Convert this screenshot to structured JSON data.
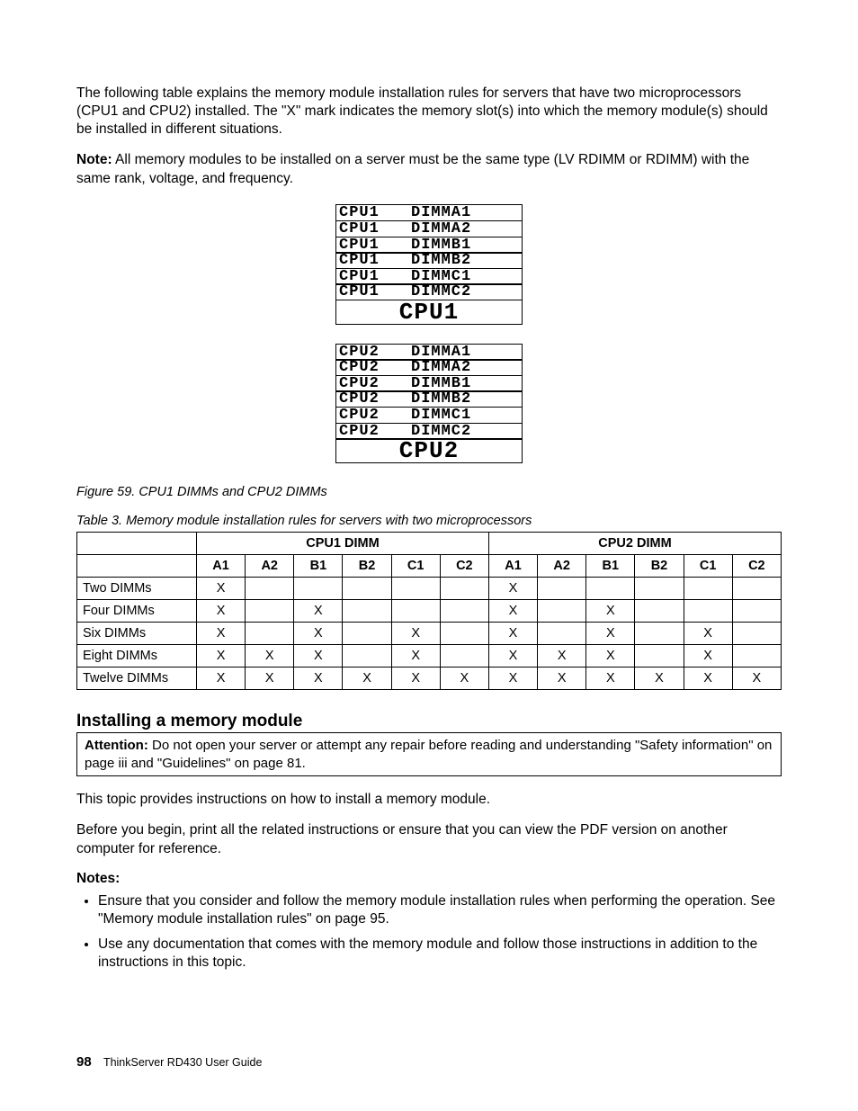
{
  "intro_para": "The following table explains the memory module installation rules for servers that have two microprocessors (CPU1 and CPU2) installed. The \"X\" mark indicates the memory slot(s) into which the memory module(s) should be installed in different situations.",
  "note_label": "Note:",
  "note_text": " All memory modules to be installed on a server must be the same type (LV RDIMM or RDIMM) with the same rank, voltage, and frequency.",
  "diagram": {
    "cpu1_rows": [
      [
        "CPU1",
        "DIMMA1"
      ],
      [
        "CPU1",
        "DIMMA2"
      ],
      [
        "CPU1",
        "DIMMB1"
      ],
      [
        "CPU1",
        "DIMMB2"
      ],
      [
        "CPU1",
        "DIMMC1"
      ],
      [
        "CPU1",
        "DIMMC2"
      ]
    ],
    "cpu1_label": "CPU1",
    "cpu2_rows": [
      [
        "CPU2",
        "DIMMA1"
      ],
      [
        "CPU2",
        "DIMMA2"
      ],
      [
        "CPU2",
        "DIMMB1"
      ],
      [
        "CPU2",
        "DIMMB2"
      ],
      [
        "CPU2",
        "DIMMC1"
      ],
      [
        "CPU2",
        "DIMMC2"
      ]
    ],
    "cpu2_label": "CPU2"
  },
  "figure_caption": "Figure 59.  CPU1 DIMMs and CPU2 DIMMs",
  "table_caption": "Table 3.  Memory module installation rules for servers with two microprocessors",
  "chart_data": {
    "type": "table",
    "title": "Memory module installation rules for servers with two microprocessors",
    "group_headers": [
      "CPU1 DIMM",
      "CPU2 DIMM"
    ],
    "column_headers": [
      "A1",
      "A2",
      "B1",
      "B2",
      "C1",
      "C2",
      "A1",
      "A2",
      "B1",
      "B2",
      "C1",
      "C2"
    ],
    "rows": [
      {
        "label": "Two DIMMs",
        "cells": [
          "X",
          "",
          "",
          "",
          "",
          "",
          "X",
          "",
          "",
          "",
          "",
          ""
        ]
      },
      {
        "label": "Four DIMMs",
        "cells": [
          "X",
          "",
          "X",
          "",
          "",
          "",
          "X",
          "",
          "X",
          "",
          "",
          ""
        ]
      },
      {
        "label": "Six DIMMs",
        "cells": [
          "X",
          "",
          "X",
          "",
          "X",
          "",
          "X",
          "",
          "X",
          "",
          "X",
          ""
        ]
      },
      {
        "label": "Eight DIMMs",
        "cells": [
          "X",
          "X",
          "X",
          "",
          "X",
          "",
          "X",
          "X",
          "X",
          "",
          "X",
          ""
        ]
      },
      {
        "label": "Twelve DIMMs",
        "cells": [
          "X",
          "X",
          "X",
          "X",
          "X",
          "X",
          "X",
          "X",
          "X",
          "X",
          "X",
          "X"
        ]
      }
    ]
  },
  "section_heading": "Installing a memory module",
  "attention_label": "Attention:",
  "attention_text": " Do not open your server or attempt any repair before reading and understanding \"Safety information\" on page iii and \"Guidelines\" on page 81.",
  "para_after_heading": "This topic provides instructions on how to install a memory module.",
  "para_before_notes": "Before you begin, print all the related instructions or ensure that you can view the PDF version on another computer for reference.",
  "notes_heading": "Notes:",
  "notes_list": [
    "Ensure that you consider and follow the memory module installation rules when performing the operation. See \"Memory module installation rules\" on page 95.",
    "Use any documentation that comes with the memory module and follow those instructions in addition to the instructions in this topic."
  ],
  "footer_page": "98",
  "footer_text": "ThinkServer RD430 User Guide"
}
